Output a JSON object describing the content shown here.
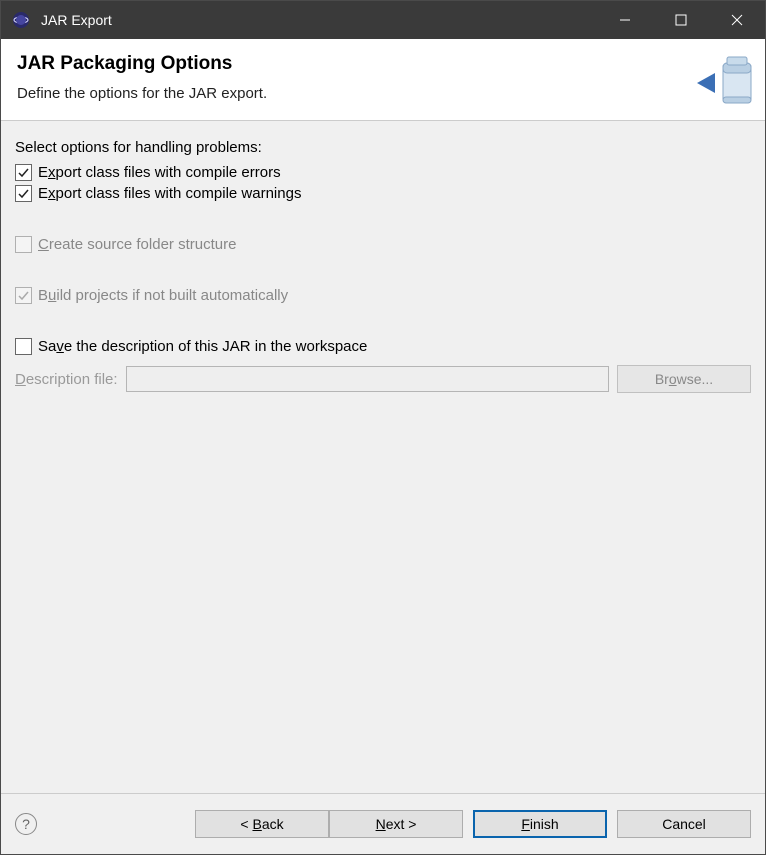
{
  "titlebar": {
    "title": "JAR Export"
  },
  "header": {
    "title": "JAR Packaging Options",
    "subtitle": "Define the options for the JAR export."
  },
  "content": {
    "problems_label": "Select options for handling problems:",
    "export_errors": {
      "pre": "E",
      "m": "x",
      "post": "port class files with compile errors",
      "checked": true
    },
    "export_warnings": {
      "pre": "E",
      "m": "x",
      "post": "port class files with compile warnings",
      "checked": true
    },
    "create_source": {
      "pre": "",
      "m": "C",
      "post": "reate source folder structure",
      "checked": false,
      "disabled": true
    },
    "build_projects": {
      "pre": "B",
      "m": "u",
      "post": "ild projects if not built automatically",
      "checked": true,
      "disabled": true
    },
    "save_desc": {
      "pre": "Sa",
      "m": "v",
      "post": "e the description of this JAR in the workspace",
      "checked": false
    },
    "desc_file": {
      "pre": "",
      "m": "D",
      "post": "escription file:"
    },
    "browse": {
      "pre": "Br",
      "m": "o",
      "post": "wse..."
    }
  },
  "footer": {
    "back": {
      "pre": "< ",
      "m": "B",
      "post": "ack"
    },
    "next": {
      "pre": "",
      "m": "N",
      "post": "ext >"
    },
    "finish": {
      "pre": "",
      "m": "F",
      "post": "inish"
    },
    "cancel": "Cancel"
  }
}
